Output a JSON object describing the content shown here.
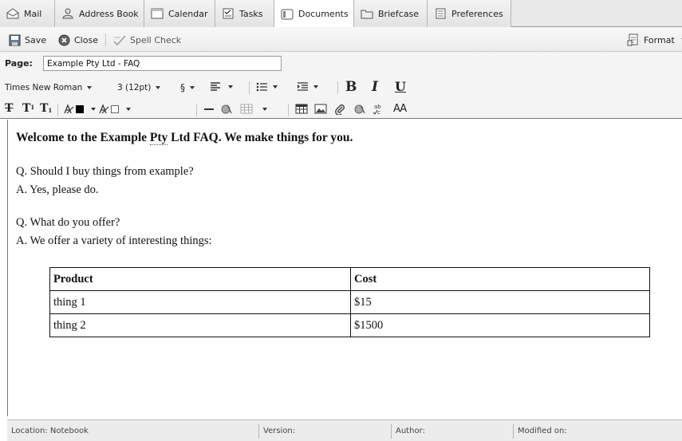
{
  "tabs": [
    {
      "label": "Mail",
      "icon": "mail-icon",
      "active": false
    },
    {
      "label": "Address Book",
      "icon": "address-book-icon",
      "active": false
    },
    {
      "label": "Calendar",
      "icon": "calendar-icon",
      "active": false
    },
    {
      "label": "Tasks",
      "icon": "tasks-icon",
      "active": false
    },
    {
      "label": "Documents",
      "icon": "documents-icon",
      "active": true
    },
    {
      "label": "Briefcase",
      "icon": "briefcase-icon",
      "active": false
    },
    {
      "label": "Preferences",
      "icon": "preferences-icon",
      "active": false
    }
  ],
  "actions": {
    "save": "Save",
    "close": "Close",
    "spell_check": "Spell Check",
    "format": "Format"
  },
  "page": {
    "label": "Page:",
    "title": "Example Pty Ltd - FAQ"
  },
  "format_bar": {
    "font_family": "Times New Roman",
    "font_size": "3 (12pt)",
    "section_symbol": "§",
    "bold": "B",
    "italic": "I",
    "underline": "U",
    "strike": "T",
    "superscript": "T",
    "superscript_mark": "1",
    "subscript": "T",
    "subscript_mark": "1",
    "case_toggle": "AA"
  },
  "document": {
    "heading_before": "Welcome to the Example ",
    "heading_pty": "Pty",
    "heading_after": " Ltd FAQ. We make things for you.",
    "lines": [
      "Q. Should I buy things from example?",
      "A. Yes, please do.",
      "Q. What do you offer?",
      "A. We offer a variety of interesting things:"
    ],
    "table": {
      "headers": [
        "Product",
        "Cost"
      ],
      "rows": [
        [
          "thing 1",
          "$15"
        ],
        [
          "thing 2",
          "$1500"
        ]
      ]
    }
  },
  "status_bar": {
    "location": "Location: Notebook",
    "version": "Version:",
    "author": "Author:",
    "modified": "Modified on:"
  }
}
